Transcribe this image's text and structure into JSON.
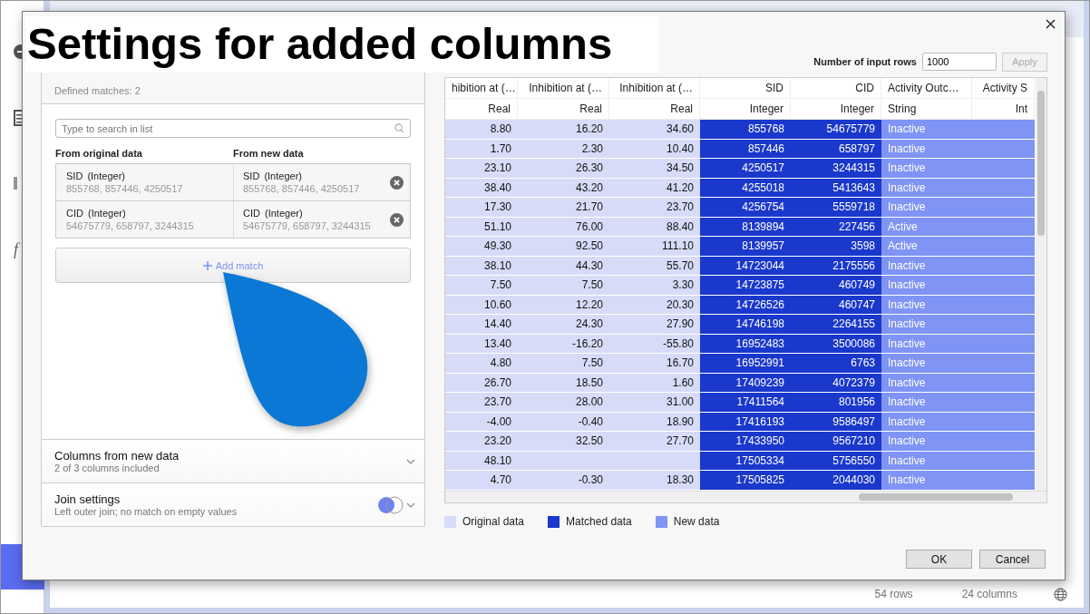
{
  "overlay_caption": "Settings for added columns",
  "background_app": {
    "sidebar_glyph": "f",
    "status": [
      "54 rows",
      "24 columns"
    ]
  },
  "matches_panel": {
    "defined_matches": "Defined matches: 2",
    "search": {
      "placeholder": "Type to search in list"
    },
    "headers": [
      "From original data",
      "From new data"
    ],
    "matches": [
      {
        "original": {
          "name": "SID",
          "type": "(Integer)",
          "values": "855768, 857446, 4250517"
        },
        "new": {
          "name": "SID",
          "type": "(Integer)",
          "values": "855768, 857446, 4250517"
        }
      },
      {
        "original": {
          "name": "CID",
          "type": "(Integer)",
          "values": "54675779, 658797, 3244315"
        },
        "new": {
          "name": "CID",
          "type": "(Integer)",
          "values": "54675779, 658797, 3244315"
        }
      }
    ],
    "add_button": "Add match"
  },
  "sections": [
    {
      "kind": "plain",
      "title": "Columns from new data",
      "subtitle": "2 of 3 columns included"
    },
    {
      "kind": "join",
      "title": "Join settings",
      "subtitle": "Left outer join; no match on empty values"
    }
  ],
  "input_rows": {
    "label": "Number of input rows",
    "value": "1000",
    "apply": "Apply",
    "apply_disabled": true
  },
  "legend": [
    {
      "label": "Original data",
      "color": "#d6dcf8"
    },
    {
      "label": "Matched data",
      "color": "#1a38cc"
    },
    {
      "label": "New data",
      "color": "#7f94f4"
    }
  ],
  "table": {
    "columns": [
      {
        "name": "hibition at (…",
        "type": "Real",
        "color": "#d6dcf8",
        "kind": "number"
      },
      {
        "name": "Inhibition at (…",
        "type": "Real",
        "color": "#d6dcf8",
        "kind": "number"
      },
      {
        "name": "Inhibition at (…",
        "type": "Real",
        "color": "#d6dcf8",
        "kind": "number"
      },
      {
        "name": "SID",
        "type": "Integer",
        "color": "#1a38cc",
        "kind": "number"
      },
      {
        "name": "CID",
        "type": "Integer",
        "color": "#1a38cc",
        "kind": "number"
      },
      {
        "name": "Activity Outc…",
        "type": "String",
        "color": "#7f94f4",
        "kind": "text"
      },
      {
        "name": "Activity S",
        "type": "Int",
        "color": "#7f94f4",
        "kind": "number"
      }
    ],
    "rows": [
      [
        "8.80",
        "16.20",
        "34.60",
        "855768",
        "54675779",
        "Inactive",
        null
      ],
      [
        "1.70",
        "2.30",
        "10.40",
        "857446",
        "658797",
        "Inactive",
        null
      ],
      [
        "23.10",
        "26.30",
        "34.50",
        "4250517",
        "3244315",
        "Inactive",
        null
      ],
      [
        "38.40",
        "43.20",
        "41.20",
        "4255018",
        "5413643",
        "Inactive",
        null
      ],
      [
        "17.30",
        "21.70",
        "23.70",
        "4256754",
        "5559718",
        "Inactive",
        null
      ],
      [
        "51.10",
        "76.00",
        "88.40",
        "8139894",
        "227456",
        "Active",
        null
      ],
      [
        "49.30",
        "92.50",
        "111.10",
        "8139957",
        "3598",
        "Active",
        null
      ],
      [
        "38.10",
        "44.30",
        "55.70",
        "14723044",
        "2175556",
        "Inactive",
        null
      ],
      [
        "7.50",
        "7.50",
        "3.30",
        "14723875",
        "460749",
        "Inactive",
        null
      ],
      [
        "10.60",
        "12.20",
        "20.30",
        "14726526",
        "460747",
        "Inactive",
        null
      ],
      [
        "14.40",
        "24.30",
        "27.90",
        "14746198",
        "2264155",
        "Inactive",
        null
      ],
      [
        "13.40",
        "-16.20",
        "-55.80",
        "16952483",
        "3500086",
        "Inactive",
        null
      ],
      [
        "4.80",
        "7.50",
        "16.70",
        "16952991",
        "6763",
        "Inactive",
        null
      ],
      [
        "26.70",
        "18.50",
        "1.60",
        "17409239",
        "4072379",
        "Inactive",
        null
      ],
      [
        "23.70",
        "28.00",
        "31.00",
        "17411564",
        "801956",
        "Inactive",
        null
      ],
      [
        "-4.00",
        "-0.40",
        "18.90",
        "17416193",
        "9586497",
        "Inactive",
        null
      ],
      [
        "23.20",
        "32.50",
        "27.70",
        "17433950",
        "9567210",
        "Inactive",
        null
      ],
      [
        "48.10",
        null,
        null,
        "17505334",
        "5756550",
        "Inactive",
        null
      ],
      [
        "4.70",
        "-0.30",
        "18.30",
        "17505825",
        "2044030",
        "Inactive",
        null
      ]
    ]
  },
  "buttons": [
    "OK",
    "Cancel"
  ]
}
